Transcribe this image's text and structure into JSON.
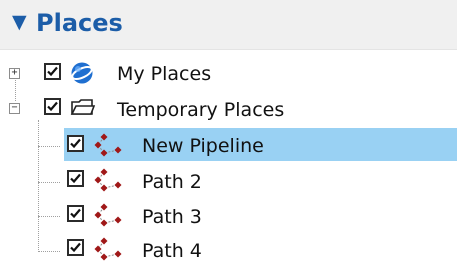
{
  "header": {
    "title": "Places",
    "toggle_glyph": "▼"
  },
  "tree": {
    "my_places": {
      "label": "My Places",
      "checked": true,
      "expander": "+",
      "icon": "globe-icon"
    },
    "temporary_places": {
      "label": "Temporary Places",
      "checked": true,
      "expander": "−",
      "icon": "folder-icon"
    },
    "children": [
      {
        "label": "New Pipeline",
        "checked": true,
        "selected": true,
        "icon": "path-icon"
      },
      {
        "label": "Path 2",
        "checked": true,
        "selected": false,
        "icon": "path-icon"
      },
      {
        "label": "Path 3",
        "checked": true,
        "selected": false,
        "icon": "path-icon"
      },
      {
        "label": "Path 4",
        "checked": true,
        "selected": false,
        "icon": "path-icon"
      }
    ]
  },
  "colors": {
    "header_text": "#1c5da8",
    "header_bg": "#f0f0f0",
    "selection": "#99d1f3",
    "path_icon": "#a01818"
  }
}
